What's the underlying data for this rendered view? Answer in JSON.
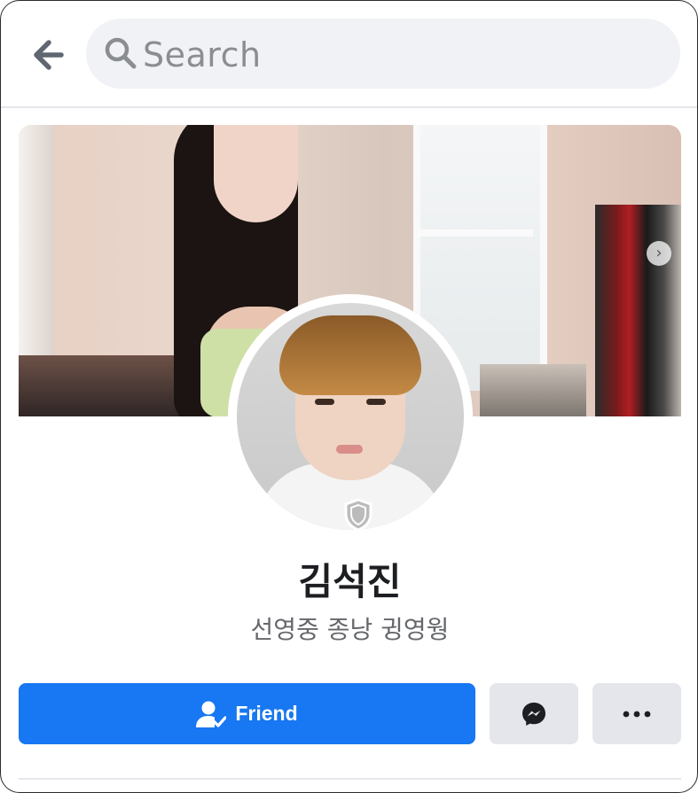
{
  "header": {
    "search_placeholder": "Search",
    "back_icon": "arrow-left-icon",
    "search_icon": "search-icon"
  },
  "cover": {
    "next_icon": "chevron-right-icon"
  },
  "profile": {
    "name": "김석진",
    "subtitle": "선영중 종낭 귕영웡",
    "badge_icon": "shield-icon"
  },
  "actions": {
    "friend_label": "Friend",
    "friend_icon": "person-check-icon",
    "message_icon": "messenger-icon",
    "more_icon": "more-dots-icon"
  },
  "colors": {
    "primary": "#1877f2",
    "secondary_button": "#e4e6eb",
    "search_bg": "#f0f2f5",
    "text_primary": "#1c1e21",
    "text_secondary": "#65676b"
  }
}
